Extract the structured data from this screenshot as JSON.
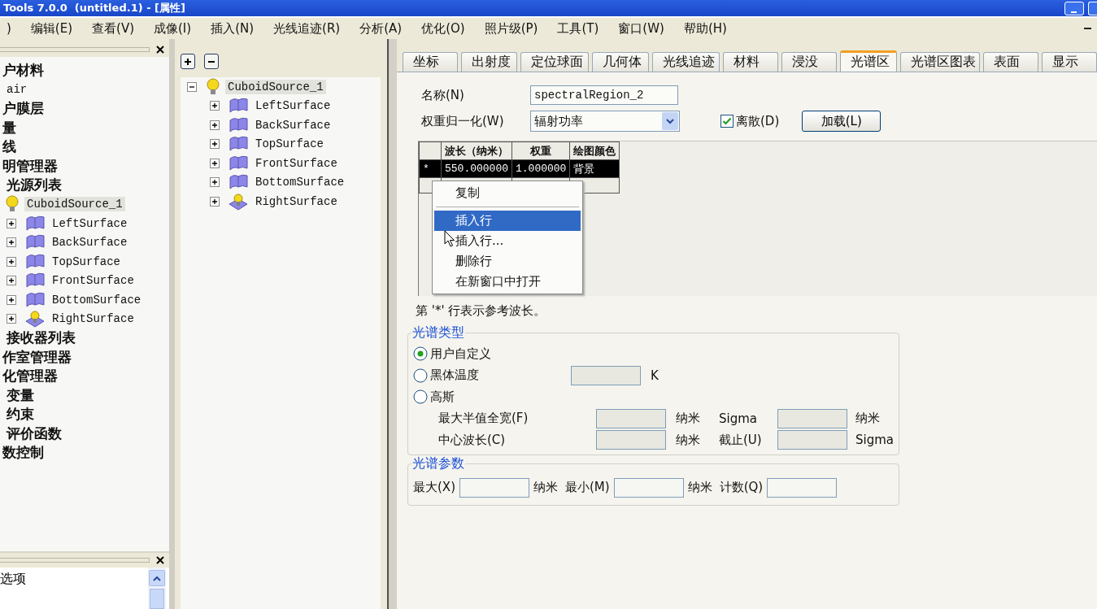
{
  "window": {
    "title": "Tools 7.0.0  (untitled.1) - [属性]"
  },
  "menu_bar": [
    ")",
    "编辑(E)",
    "查看(V)",
    "成像(I)",
    "插入(N)",
    "光线追迹(R)",
    "分析(A)",
    "优化(O)",
    "照片级(P)",
    "工具(T)",
    "窗口(W)",
    "帮助(H)"
  ],
  "left_tree": [
    {
      "label": "户材料",
      "kind": "group",
      "selected": false,
      "children": [
        {
          "label": "air",
          "kind": "item",
          "selected": false
        }
      ]
    },
    {
      "label": "户膜层",
      "kind": "group",
      "selected": false
    },
    {
      "label": "量",
      "kind": "group",
      "selected": false
    },
    {
      "label": "线",
      "kind": "group",
      "selected": false
    },
    {
      "label": "明管理器",
      "kind": "group",
      "selected": false,
      "children": [
        {
          "label": "光源列表",
          "kind": "group",
          "selected": false,
          "children": [
            {
              "label": "CuboidSource_1",
              "kind": "source",
              "selected": true,
              "children": [
                {
                  "label": "LeftSurface",
                  "kind": "surface",
                  "expanded": false,
                  "selected": false
                },
                {
                  "label": "BackSurface",
                  "kind": "surface",
                  "expanded": false,
                  "selected": false
                },
                {
                  "label": "TopSurface",
                  "kind": "surface",
                  "expanded": false,
                  "selected": false
                },
                {
                  "label": "FrontSurface",
                  "kind": "surface",
                  "expanded": false,
                  "selected": false
                },
                {
                  "label": "BottomSurface",
                  "kind": "surface",
                  "expanded": false,
                  "selected": false
                },
                {
                  "label": "RightSurface",
                  "kind": "source_surface",
                  "expanded": false,
                  "selected": false
                }
              ]
            }
          ]
        },
        {
          "label": "接收器列表",
          "kind": "group",
          "selected": false
        }
      ]
    },
    {
      "label": "作室管理器",
      "kind": "group",
      "selected": false
    },
    {
      "label": "化管理器",
      "kind": "group",
      "selected": false,
      "children": [
        {
          "label": "变量",
          "kind": "group",
          "selected": false
        },
        {
          "label": "约束",
          "kind": "group",
          "selected": false
        },
        {
          "label": "评价函数",
          "kind": "group",
          "selected": false
        }
      ]
    },
    {
      "label": "数控制",
      "kind": "group",
      "selected": false
    }
  ],
  "bottom_panel": {
    "items": [
      "选项"
    ]
  },
  "middle_tree": [
    {
      "label": "CuboidSource_1",
      "kind": "source",
      "expanded": true,
      "selected": true,
      "children": [
        {
          "label": "LeftSurface",
          "kind": "surface",
          "expanded": false,
          "selected": false
        },
        {
          "label": "BackSurface",
          "kind": "surface",
          "expanded": false,
          "selected": false
        },
        {
          "label": "TopSurface",
          "kind": "surface",
          "expanded": false,
          "selected": false
        },
        {
          "label": "FrontSurface",
          "kind": "surface",
          "expanded": false,
          "selected": false
        },
        {
          "label": "BottomSurface",
          "kind": "surface",
          "expanded": false,
          "selected": false
        },
        {
          "label": "RightSurface",
          "kind": "source_surface",
          "expanded": false,
          "selected": false
        }
      ]
    }
  ],
  "tabs": [
    {
      "label": "坐标",
      "selected": false
    },
    {
      "label": "出射度",
      "selected": false
    },
    {
      "label": "定位球面",
      "selected": false
    },
    {
      "label": "几何体",
      "selected": false
    },
    {
      "label": "光线追迹",
      "selected": false
    },
    {
      "label": "材料",
      "selected": false
    },
    {
      "label": "浸没",
      "selected": false
    },
    {
      "label": "光谱区",
      "selected": true
    },
    {
      "label": "光谱区图表",
      "selected": false
    },
    {
      "label": "表面",
      "selected": false
    },
    {
      "label": "显示",
      "selected": false
    }
  ],
  "form": {
    "name_label": "名称(N)",
    "name_value": "spectralRegion_2",
    "weight_label": "权重归一化(W)",
    "weight_value": "辐射功率",
    "discrete": {
      "label": "离散(D)",
      "checked": true
    },
    "load_button": "加载(L)"
  },
  "table": {
    "columns": [
      "波长（纳米）",
      "权重",
      "绘图颜色"
    ],
    "rows": [
      {
        "marker": "*",
        "cells": [
          "550.000000",
          "1.000000",
          "背景"
        ],
        "selected": true
      }
    ]
  },
  "context_menu": [
    {
      "label": "复制",
      "selected": false,
      "separator_after": true
    },
    {
      "label": "插入行",
      "selected": true,
      "separator_after": false
    },
    {
      "label": "插入行...",
      "selected": false,
      "separator_after": false
    },
    {
      "label": "删除行",
      "selected": false,
      "separator_after": false
    },
    {
      "label": "在新窗口中打开",
      "selected": false,
      "separator_after": false
    }
  ],
  "note": "第 '*' 行表示参考波长。",
  "spectrum_type": {
    "title": "光谱类型",
    "rows": [
      {
        "kind": "radio",
        "label": "用户自定义",
        "selected": true
      },
      {
        "kind": "radio",
        "label": "黑体温度",
        "selected": false,
        "disabled": true,
        "unit": "K"
      },
      {
        "kind": "radio",
        "label": "高斯",
        "selected": false
      },
      {
        "kind": "pair",
        "label": "最大半值全宽(F)",
        "unit": "纳米",
        "label_2": "Sigma",
        "unit_2": "纳米",
        "disabled": true
      },
      {
        "kind": "pair",
        "label": "中心波长(C)",
        "unit": "纳米",
        "label_2": "截止(U)",
        "unit_2": "Sigma",
        "disabled": true
      }
    ]
  },
  "spectrum_params": {
    "title": "光谱参数",
    "fields": [
      {
        "label": "最大(X)",
        "unit": "纳米"
      },
      {
        "label": "最小(M)",
        "unit": "纳米"
      },
      {
        "label": "计数(Q)"
      }
    ]
  }
}
